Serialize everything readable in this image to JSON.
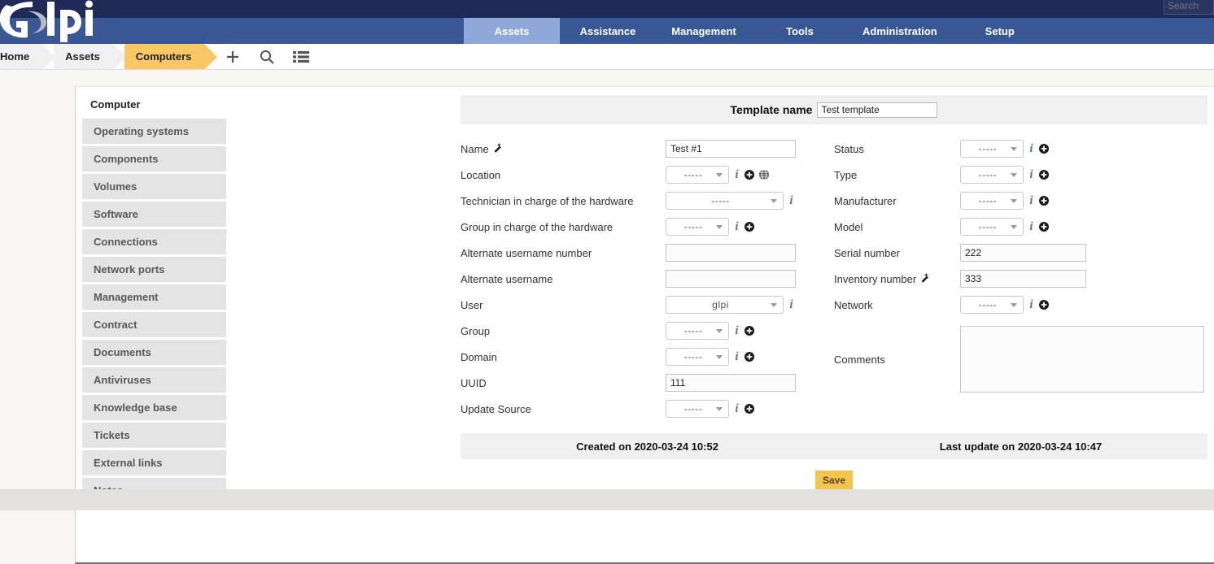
{
  "topbar": {
    "search_placeholder": "Search",
    "search_value": ""
  },
  "nav": {
    "items": [
      {
        "label": "Assets",
        "active": true
      },
      {
        "label": "Assistance",
        "active": false
      },
      {
        "label": "Management",
        "active": false
      },
      {
        "label": "Tools",
        "active": false
      },
      {
        "label": "Administration",
        "active": false
      },
      {
        "label": "Setup",
        "active": false
      }
    ]
  },
  "breadcrumb": {
    "items": [
      {
        "label": "Home",
        "active": false
      },
      {
        "label": "Assets",
        "active": false
      },
      {
        "label": "Computers",
        "active": true
      }
    ],
    "tools": [
      {
        "name": "add-icon",
        "glyph": "+"
      },
      {
        "name": "search-icon",
        "glyph": "search"
      },
      {
        "name": "list-view-icon",
        "glyph": "list"
      }
    ]
  },
  "sidebar": {
    "title": "Computer",
    "items": [
      {
        "label": "Operating systems"
      },
      {
        "label": "Components"
      },
      {
        "label": "Volumes"
      },
      {
        "label": "Software"
      },
      {
        "label": "Connections"
      },
      {
        "label": "Network ports"
      },
      {
        "label": "Management"
      },
      {
        "label": "Contract"
      },
      {
        "label": "Documents"
      },
      {
        "label": "Antiviruses"
      },
      {
        "label": "Knowledge base"
      },
      {
        "label": "Tickets"
      },
      {
        "label": "External links"
      },
      {
        "label": "Notes"
      }
    ]
  },
  "form": {
    "template_name_label": "Template name",
    "template_name_value": "Test template",
    "left": {
      "name_label": "Name",
      "name_value": "Test #1",
      "location_label": "Location",
      "location_value": "-----",
      "technician_label": "Technician in charge of the hardware",
      "technician_value": "-----",
      "group_charge_label": "Group in charge of the hardware",
      "group_charge_value": "-----",
      "alt_username_number_label": "Alternate username number",
      "alt_username_number_value": "",
      "alt_username_label": "Alternate username",
      "alt_username_value": "",
      "user_label": "User",
      "user_value": "glpi",
      "group_label": "Group",
      "group_value": "-----",
      "domain_label": "Domain",
      "domain_value": "-----",
      "uuid_label": "UUID",
      "uuid_value": "111",
      "update_source_label": "Update Source",
      "update_source_value": "-----"
    },
    "right": {
      "status_label": "Status",
      "status_value": "-----",
      "type_label": "Type",
      "type_value": "-----",
      "manufacturer_label": "Manufacturer",
      "manufacturer_value": "-----",
      "model_label": "Model",
      "model_value": "-----",
      "serial_label": "Serial number",
      "serial_value": "222",
      "inventory_label": "Inventory number",
      "inventory_value": "333",
      "network_label": "Network",
      "network_value": "-----",
      "comments_label": "Comments",
      "comments_value": ""
    },
    "created_on": "Created on 2020-03-24 10:52",
    "last_update": "Last update on 2020-03-24 10:47",
    "save_label": "Save"
  },
  "colors": {
    "topbar": "#1f2b56",
    "navbar": "#3a5795",
    "nav_active": "#8fa8d8",
    "crumb_active": "#fbc764",
    "save": "#f3c44e",
    "sidebar_item": "#e4e4e4",
    "page_bg": "#f7f6f2"
  }
}
